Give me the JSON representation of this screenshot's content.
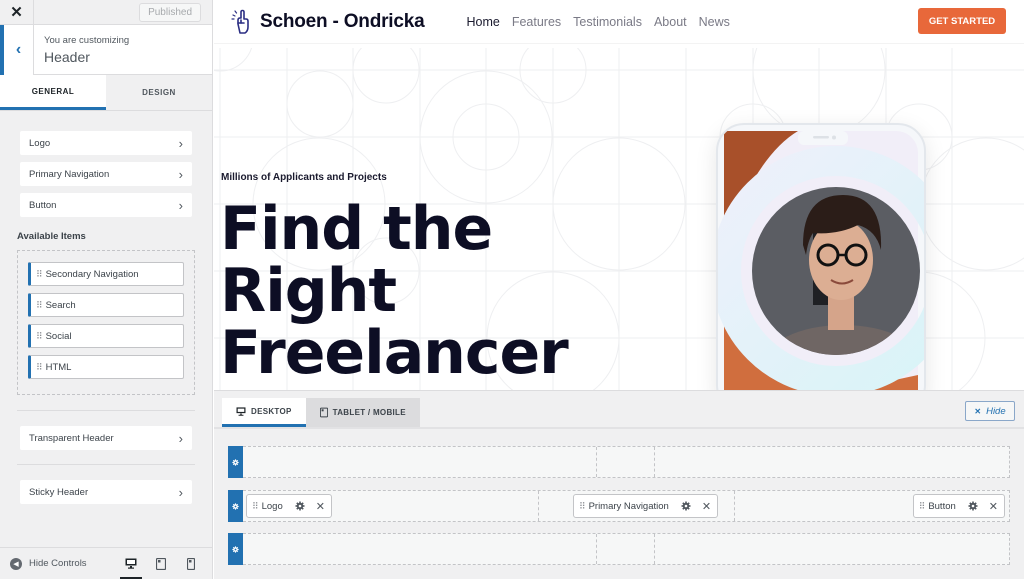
{
  "sidebar": {
    "close_icon": "close-icon",
    "published_label": "Published",
    "context_small": "You are customizing",
    "context_title": "Header",
    "tabs": [
      {
        "label": "GENERAL",
        "active": true
      },
      {
        "label": "DESIGN",
        "active": false
      }
    ],
    "sections": [
      {
        "label": "Logo"
      },
      {
        "label": "Primary Navigation"
      },
      {
        "label": "Button"
      }
    ],
    "available_title": "Available Items",
    "available_items": [
      {
        "label": "Secondary Navigation"
      },
      {
        "label": "Search"
      },
      {
        "label": "Social"
      },
      {
        "label": "HTML"
      }
    ],
    "extra_sections": [
      {
        "label": "Transparent Header"
      },
      {
        "label": "Sticky Header"
      }
    ],
    "footer": {
      "hide_controls_label": "Hide Controls",
      "devices": [
        "desktop",
        "tablet",
        "mobile"
      ],
      "active_device": "desktop"
    }
  },
  "preview": {
    "site_name": "Schoen - Ondricka",
    "nav": [
      {
        "label": "Home",
        "current": true
      },
      {
        "label": "Features",
        "current": false
      },
      {
        "label": "Testimonials",
        "current": false
      },
      {
        "label": "About",
        "current": false
      },
      {
        "label": "News",
        "current": false
      }
    ],
    "cta_label": "GET STARTED",
    "hero_subtitle": "Millions of Applicants and Projects",
    "hero_title_lines": [
      "Find the",
      "Right",
      "Freelancer"
    ],
    "colors": {
      "accent": "#e8683a",
      "dark": "#0d0e24"
    }
  },
  "builder": {
    "tabs": [
      {
        "label": "DESKTOP",
        "active": true
      },
      {
        "label": "TABLET / MOBILE",
        "active": false
      }
    ],
    "hide_label": "Hide",
    "rows": [
      {
        "name": "top",
        "left": [],
        "middle": [],
        "right": []
      },
      {
        "name": "main",
        "left": [
          "Logo"
        ],
        "middle": [
          "Primary Navigation"
        ],
        "right": [
          "Button"
        ]
      },
      {
        "name": "bottom",
        "left": [],
        "middle": [],
        "right": []
      }
    ]
  },
  "colors": {
    "wp_blue": "#2271b1",
    "panel_bg": "#f0f0f1"
  }
}
